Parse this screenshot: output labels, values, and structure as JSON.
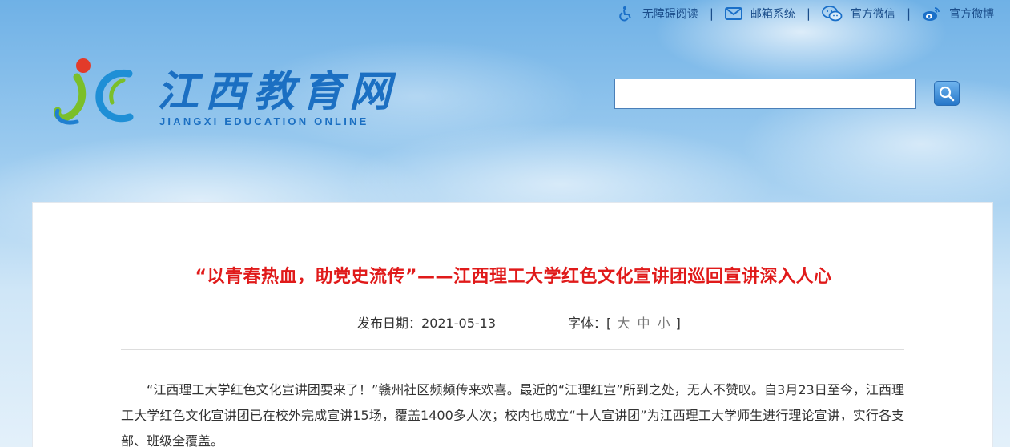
{
  "topbar": {
    "accessible": "无障碍阅读",
    "mail": "邮箱系统",
    "wechat": "官方微信",
    "weibo": "官方微博",
    "separator": "|"
  },
  "logo": {
    "cn": "江西教育网",
    "en": "JIANGXI EDUCATION ONLINE"
  },
  "search": {
    "value": "",
    "placeholder": ""
  },
  "article": {
    "title": "“以青春热血，助党史流传”——江西理工大学红色文化宣讲团巡回宣讲深入人心",
    "date_label": "发布日期：",
    "date": "2021-05-13",
    "font_label": "字体：[",
    "font_large": "大",
    "font_medium": "中",
    "font_small": "小",
    "font_close": "]",
    "paragraph": "“江西理工大学红色文化宣讲团要来了！”赣州社区频频传来欢喜。最近的“江理红宣”所到之处，无人不赞叹。自3月23日至今，江西理工大学红色文化宣讲团已在校外完成宣讲15场，覆盖1400多人次；校内也成立“十人宣讲团”为江西理工大学师生进行理论宣讲，实行各支部、班级全覆盖。"
  },
  "colors": {
    "title_red": "#e01a1a",
    "brand_blue": "#1b6fc2",
    "link_blue": "#1a4d8a"
  }
}
